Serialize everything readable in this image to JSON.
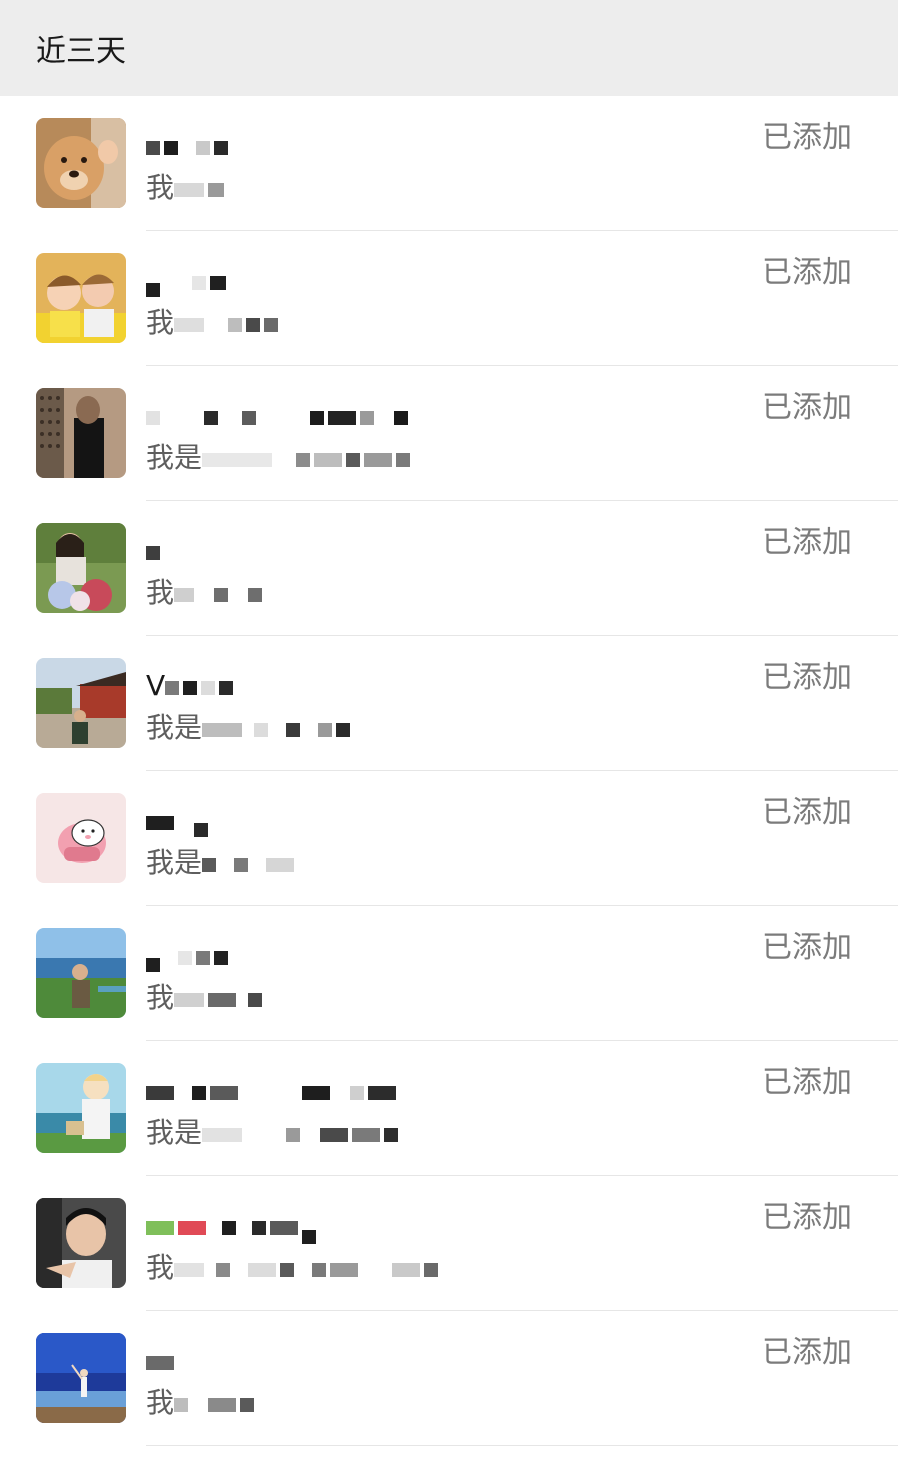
{
  "header": {
    "title": "近三天"
  },
  "contacts": [
    {
      "greeting_prefix": "我",
      "status": "已添加",
      "avatar": "dog-photo"
    },
    {
      "greeting_prefix": "我",
      "status": "已添加",
      "avatar": "two-children-photo"
    },
    {
      "greeting_prefix": "我是",
      "status": "已添加",
      "avatar": "person-portrait-photo"
    },
    {
      "greeting_prefix": "我",
      "status": "已添加",
      "avatar": "woman-with-flowers-photo"
    },
    {
      "name_prefix": "V",
      "greeting_prefix": "我是",
      "status": "已添加",
      "avatar": "temple-photo"
    },
    {
      "greeting_prefix": "我是",
      "status": "已添加",
      "avatar": "cartoon-pig-icon"
    },
    {
      "greeting_prefix": "我",
      "status": "已添加",
      "avatar": "lakeside-woman-photo"
    },
    {
      "greeting_prefix": "我是",
      "status": "已添加",
      "avatar": "illustrated-boy-photo"
    },
    {
      "greeting_prefix": "我",
      "status": "已添加",
      "avatar": "young-man-selfie-photo"
    },
    {
      "greeting_prefix": "我",
      "status": "已添加",
      "avatar": "beach-person-photo"
    }
  ]
}
